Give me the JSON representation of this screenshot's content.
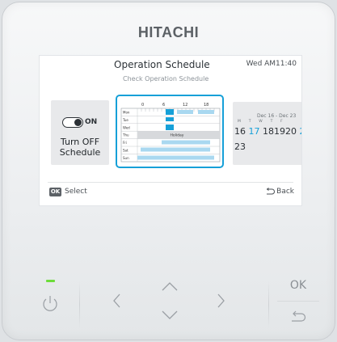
{
  "brand": "HITACHI",
  "screen": {
    "title": "Operation Schedule",
    "subtitle": "Check Operation Schedule",
    "datetime": "Wed AM11:40",
    "toggle_state": "ON",
    "off_schedule_label_line1": "Turn OFF",
    "off_schedule_label_line2": "Schedule",
    "schedule": {
      "hours": [
        "0",
        "6",
        "12",
        "18"
      ],
      "days": [
        "Mon",
        "Tue",
        "Wed",
        "Thu",
        "Fri",
        "Sat",
        "Sun"
      ],
      "holiday_label": "Holiday",
      "accent_color": "#16a0d8",
      "light_color": "#a9d8f0"
    },
    "calendar": {
      "range": "Dec 16 - Dec 23",
      "weekdays": "M T W T F",
      "dates_row1": [
        "16",
        "17",
        "18",
        "19",
        "20",
        "2"
      ],
      "dates_row2": "23"
    },
    "footer": {
      "ok_badge": "OK",
      "select_label": "Select",
      "back_label": "Back"
    }
  },
  "buttons": {
    "ok_label": "OK"
  },
  "colors": {
    "power_led": "#6ddc3a",
    "selection_border": "#16a0d8"
  }
}
